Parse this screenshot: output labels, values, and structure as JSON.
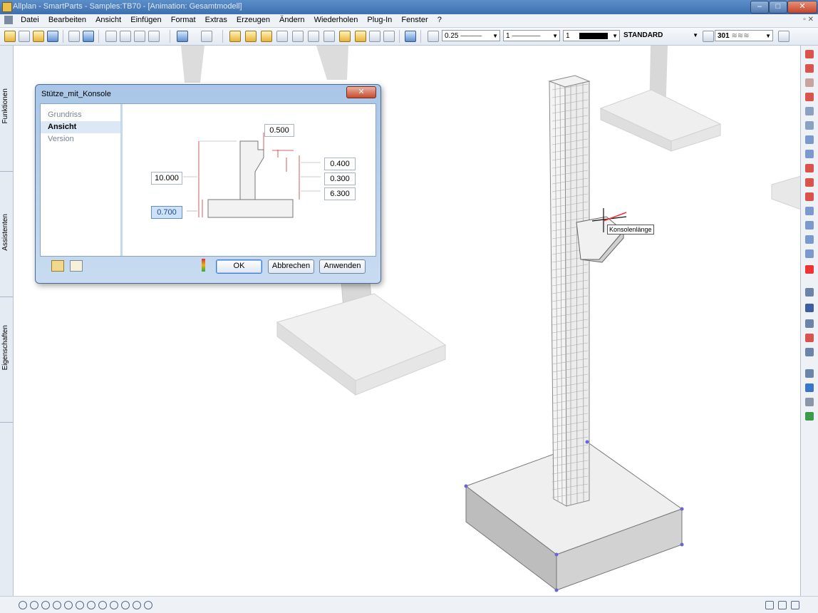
{
  "window": {
    "title": "Allplan - SmartParts - Samples:TB70 - [Animation: Gesamtmodell]",
    "minimize": "–",
    "maximize": "□",
    "close": "✕"
  },
  "menu": {
    "items": [
      "Datei",
      "Bearbeiten",
      "Ansicht",
      "Einfügen",
      "Format",
      "Extras",
      "Erzeugen",
      "Ändern",
      "Wiederholen",
      "Plug-In",
      "Fenster",
      "?"
    ],
    "mdi_controls": "▫ ✕"
  },
  "toolbar": {
    "pen_value": "0.25",
    "line_value": "1",
    "color_value": "1",
    "layer_value": "STANDARD",
    "hatch_value": "301"
  },
  "left_tabs": {
    "functions": "Funktionen",
    "assistants": "Assistenten",
    "properties": "Eigenschaften"
  },
  "dialog": {
    "title": "Stütze_mit_Konsole",
    "close": "✕",
    "nav": [
      "Grundriss",
      "Ansicht",
      "Version"
    ],
    "selected_nav": "Ansicht",
    "dims": {
      "top": "0.500",
      "left": "10.000",
      "left_active": "0.700",
      "right1": "0.400",
      "right2": "0.300",
      "right3": "6.300"
    },
    "ok": "OK",
    "cancel": "Abbrechen",
    "apply": "Anwenden"
  },
  "viewport": {
    "tooltip": "Konsolenlänge"
  },
  "colors": {
    "title_bar": "#3e6fae",
    "dialog_frame": "#a9c6e8",
    "selection": "#dce8f6"
  }
}
